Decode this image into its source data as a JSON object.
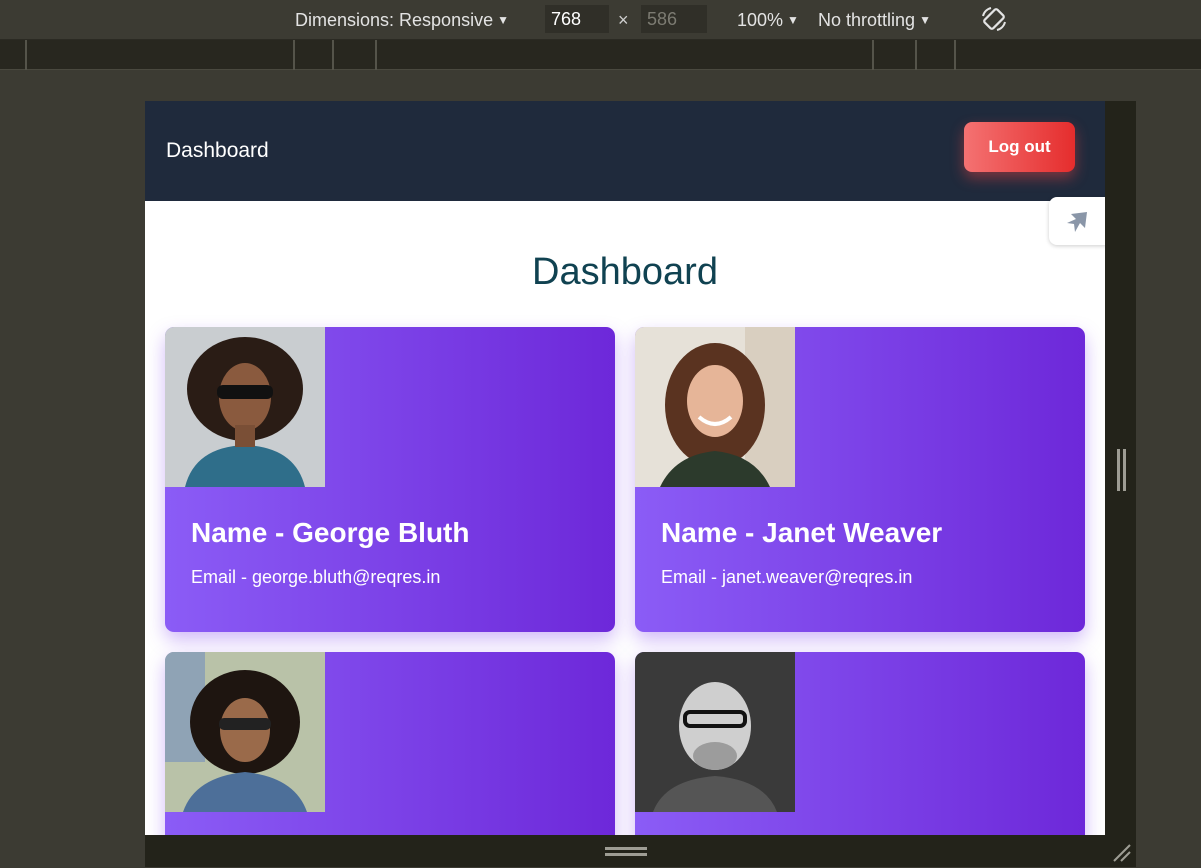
{
  "devtools": {
    "dimensions_label": "Dimensions: Responsive",
    "width_value": "768",
    "height_value": "586",
    "times_glyph": "×",
    "zoom_label": "100%",
    "throttling_label": "No throttling",
    "icons": [
      "dropdown-caret-icon",
      "rotate-device-icon",
      "resize-handle-icon"
    ]
  },
  "navbar": {
    "brand": "Dashboard",
    "logout_label": "Log out",
    "colors": {
      "background": "#1f2a3c",
      "logout_from": "#f47272",
      "logout_to": "#e52d2d"
    }
  },
  "floating_tab": {
    "icon": "rocket-icon"
  },
  "main": {
    "title": "Dashboard",
    "title_color": "#104251",
    "card_gradient": [
      "#8b5cf6",
      "#6d28d9"
    ],
    "users": [
      {
        "name": "Name - George Bluth",
        "email": "Email - george.bluth@reqres.in",
        "avatar": "man-curly-hair-sunglasses-photo"
      },
      {
        "name": "Name - Janet Weaver",
        "email": "Email - janet.weaver@reqres.in",
        "avatar": "woman-smiling-photo"
      },
      {
        "avatar": "woman-curly-hair-sunglasses-photo"
      },
      {
        "avatar": "bald-man-glasses-photo"
      }
    ]
  }
}
